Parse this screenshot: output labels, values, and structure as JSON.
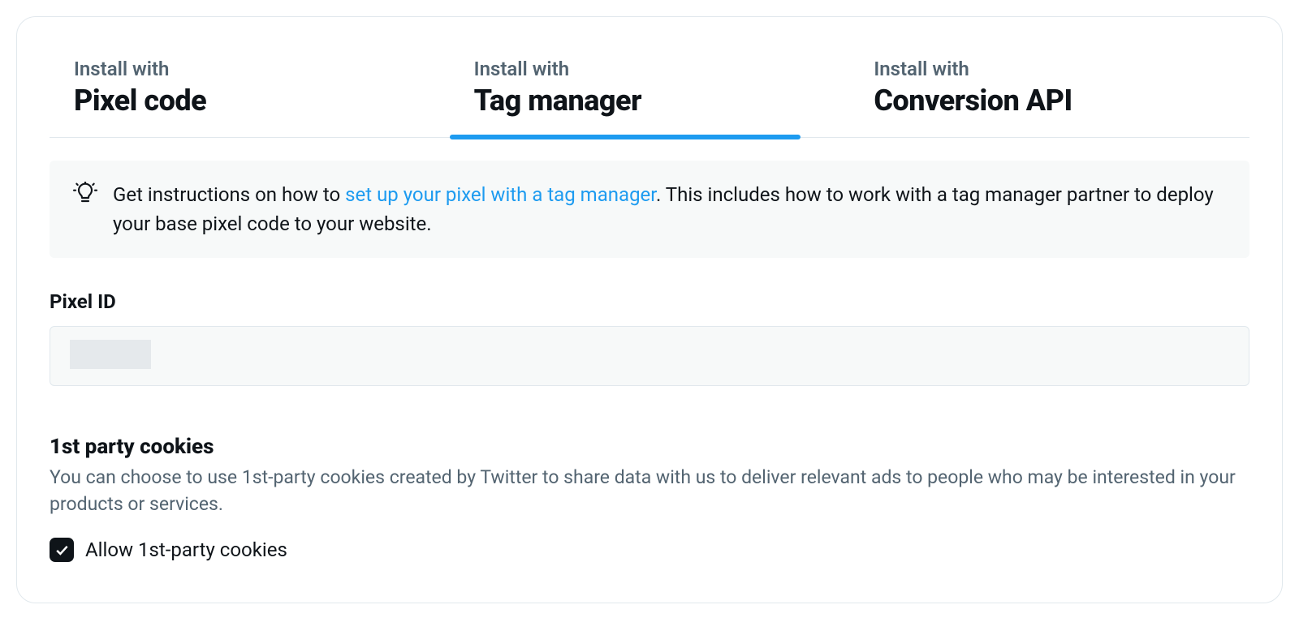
{
  "tabs": [
    {
      "overline": "Install with",
      "title": "Pixel code",
      "active": false
    },
    {
      "overline": "Install with",
      "title": "Tag manager",
      "active": true
    },
    {
      "overline": "Install with",
      "title": "Conversion API",
      "active": false
    }
  ],
  "info": {
    "text_before": "Get instructions on how to ",
    "link_text": "set up your pixel with a tag manager",
    "text_after": ". This includes how to work with a tag manager partner to deploy your base pixel code to your website."
  },
  "pixel_id": {
    "label": "Pixel ID",
    "value": ""
  },
  "cookies": {
    "heading": "1st party cookies",
    "description": "You can choose to use 1st-party cookies created by Twitter to share data with us to deliver relevant ads to people who may be interested in your products or services.",
    "checkbox_label": "Allow 1st-party cookies",
    "checked": true
  }
}
